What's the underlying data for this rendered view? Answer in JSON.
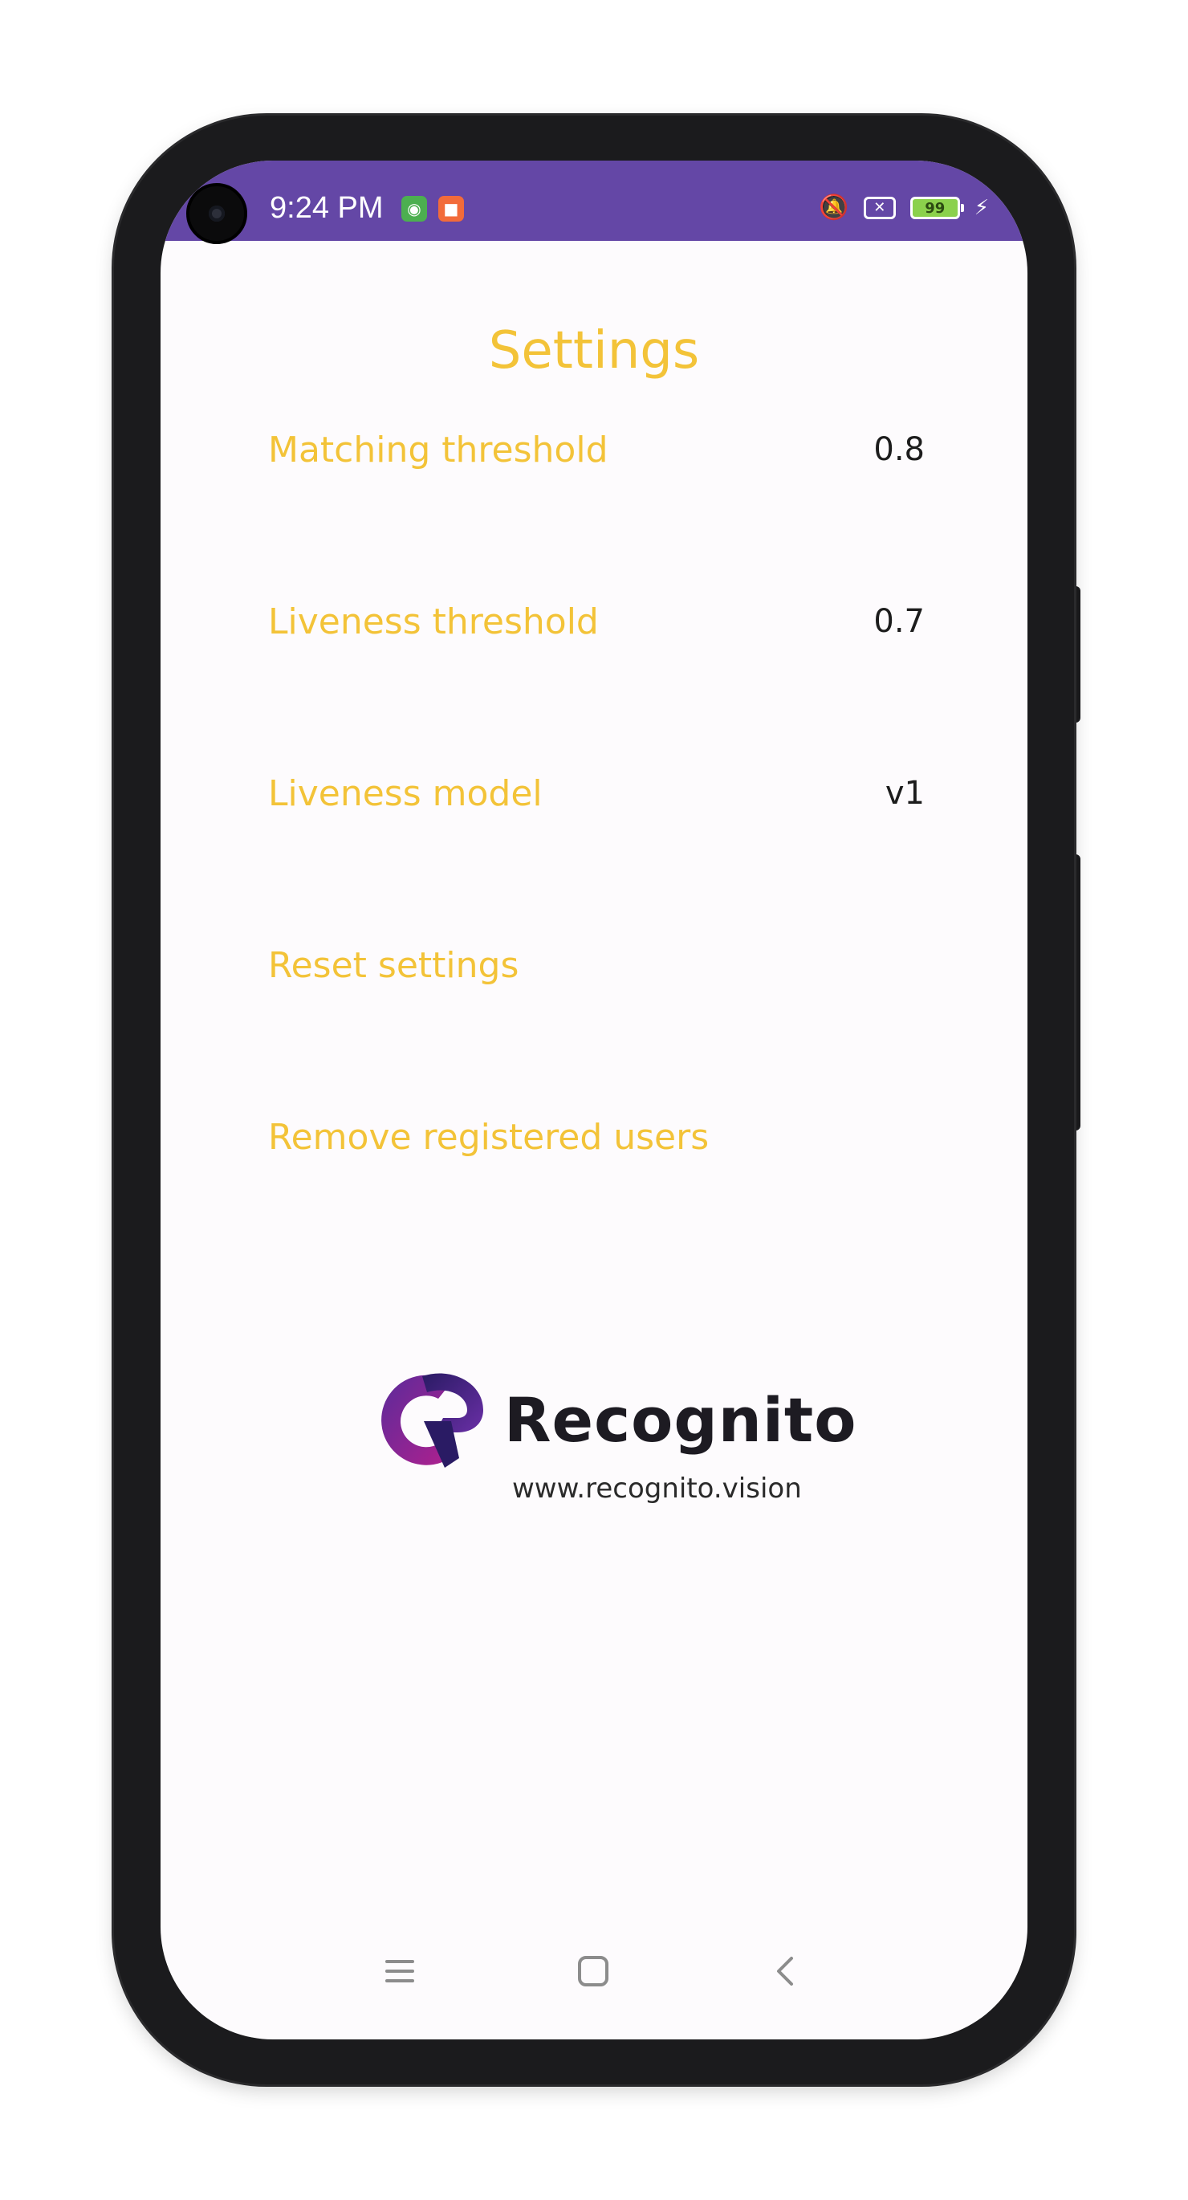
{
  "status_bar": {
    "time": "9:24 PM",
    "battery": "99",
    "color": "#6447a6"
  },
  "page": {
    "title": "Settings",
    "accent_color": "#f3c338"
  },
  "settings": [
    {
      "label": "Matching threshold",
      "value": "0.8"
    },
    {
      "label": "Liveness threshold",
      "value": "0.7"
    },
    {
      "label": "Liveness model",
      "value": "v1"
    },
    {
      "label": "Reset settings",
      "value": ""
    },
    {
      "label": "Remove registered users",
      "value": ""
    }
  ],
  "logo": {
    "name": "Recognito",
    "url": "www.recognito.vision"
  },
  "icons": {
    "notification_1": "android-icon",
    "notification_2": "video-icon",
    "status_1": "vibrate-off-icon",
    "status_2": "sim-x-icon",
    "status_3": "battery-icon",
    "status_4": "charging-icon",
    "nav_1": "menu-icon",
    "nav_2": "home-icon",
    "nav_3": "back-icon"
  }
}
